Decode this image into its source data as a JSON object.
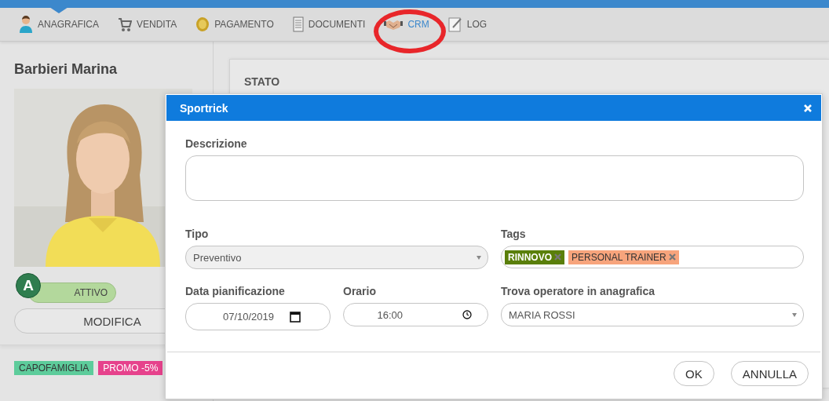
{
  "nav": {
    "tabs": [
      {
        "label": "ANAGRAFICA",
        "selected": false,
        "current": true
      },
      {
        "label": "VENDITA",
        "selected": false,
        "current": false
      },
      {
        "label": "PAGAMENTO",
        "selected": false,
        "current": false
      },
      {
        "label": "DOCUMENTI",
        "selected": false,
        "current": false
      },
      {
        "label": "CRM",
        "selected": true,
        "current": false
      },
      {
        "label": "LOG",
        "selected": false,
        "current": false
      }
    ]
  },
  "customer": {
    "name": "Barbieri Marina",
    "status": {
      "initial": "A",
      "label": "ATTIVO"
    },
    "edit_button": "MODIFICA",
    "tags": [
      {
        "label": "CAPOFAMIGLIA",
        "color": "#5dcc9b"
      },
      {
        "label": "PROMO -5%",
        "color": "#e6428c"
      }
    ]
  },
  "panel": {
    "title": "STATO"
  },
  "dialog": {
    "title": "Sportrick",
    "description_label": "Descrizione",
    "type_label": "Tipo",
    "type_value": "Preventivo",
    "tags_label": "Tags",
    "tags": [
      {
        "label": "RINNOVO",
        "color": "#5a7f0a"
      },
      {
        "label": "PERSONAL TRAINER",
        "color": "#f7a47c"
      }
    ],
    "date_label": "Data pianificazione",
    "date_value": "07/10/2019",
    "time_label": "Orario",
    "time_value": "16:00",
    "operator_label": "Trova operatore in anagrafica",
    "operator_value": "MARIA ROSSI",
    "buttons": [
      "OK",
      "ANNULLA"
    ]
  }
}
